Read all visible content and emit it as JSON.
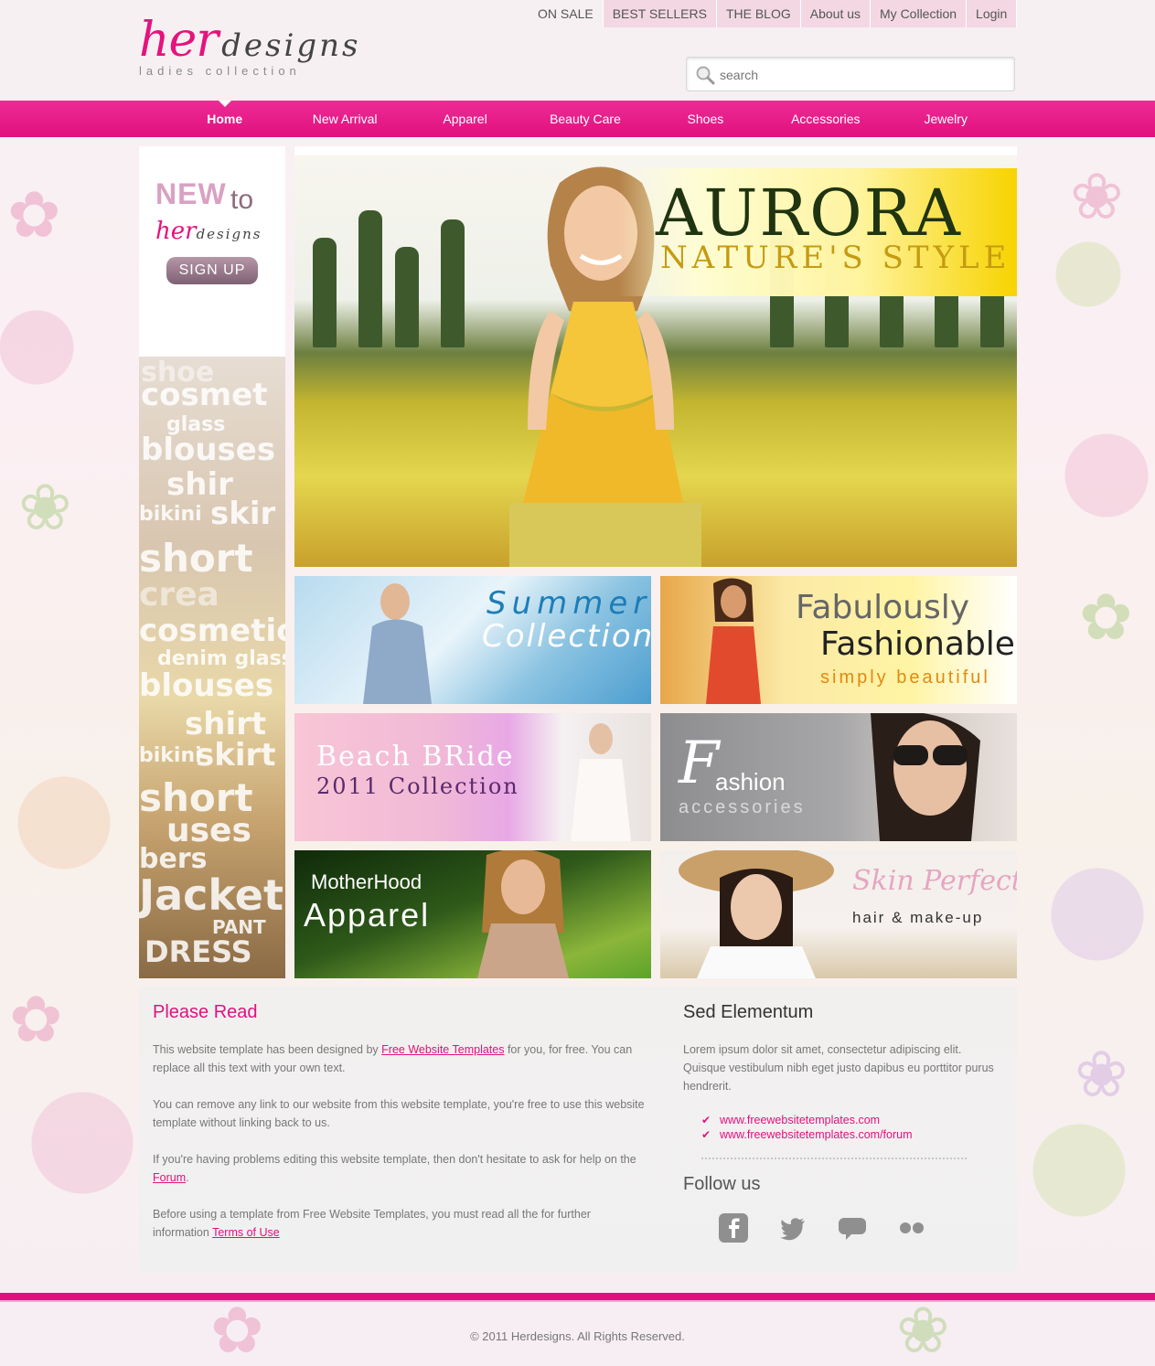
{
  "brand": {
    "logo_her": "her",
    "logo_designs": "designs",
    "tagline": "ladies collection"
  },
  "topnav": [
    "ON SALE",
    "BEST SELLERS",
    "THE BLOG",
    "About us",
    "My Collection",
    "Login"
  ],
  "search": {
    "placeholder": "search"
  },
  "mainnav": [
    "Home",
    "New Arrival",
    "Apparel",
    "Beauty Care",
    "Shoes",
    "Accessories",
    "Jewelry"
  ],
  "sidebar": {
    "new": "NEW",
    "to": "to",
    "brand_her": "her",
    "brand_designs": "designs",
    "signup": "SIGN UP"
  },
  "hero": {
    "title": "AURORA",
    "subtitle": "NATURE'S STYLE"
  },
  "tiles": {
    "summer": {
      "line1": "Summer",
      "line2": "Collection"
    },
    "fabulous": {
      "line1": "Fabulously",
      "line2": "Fashionable",
      "line3": "simply beautiful"
    },
    "bride": {
      "line1": "Beach BRide",
      "line2": "2011 Collection"
    },
    "fashion": {
      "big": "F",
      "line1": "ashion",
      "line2": "accessories"
    },
    "motherhood": {
      "line1": "MotherHood",
      "line2": "Apparel"
    },
    "skin": {
      "line1": "Skin Perfect",
      "line2": "hair & make-up"
    }
  },
  "content": {
    "heading": "Please Read",
    "p1_a": "This website template has been designed by ",
    "p1_link": "Free Website Templates",
    "p1_b": " for you, for free. You can replace all this text with your own text.",
    "p2": "You can remove any link to our website from this website template, you're free to use this website template without linking back to us.",
    "p3_a": "If you're having problems editing this website template, then don't hesitate to ask for help on the ",
    "p3_link": "Forum",
    "p3_b": ".",
    "p4_a": "Before using a template from Free Website Templates, you must read all the for further information ",
    "p4_link": "Terms of Use"
  },
  "aside": {
    "heading": "Sed Elementum",
    "text": "Lorem ipsum dolor sit amet, consectetur adipiscing elit. Quisque vestibulum nibh eget justo dapibus eu porttitor purus hendrerit.",
    "links": [
      "www.freewebsitetemplates.com",
      "www.freewebsitetemplates.com/forum"
    ],
    "follow": "Follow us"
  },
  "footer": {
    "copyright": "© 2011 Herdesigns. All Rights Reserved."
  },
  "colors": {
    "accent": "#e0117f",
    "nav_pink": "#ee2b95",
    "light_pink": "#f3d8e4"
  }
}
